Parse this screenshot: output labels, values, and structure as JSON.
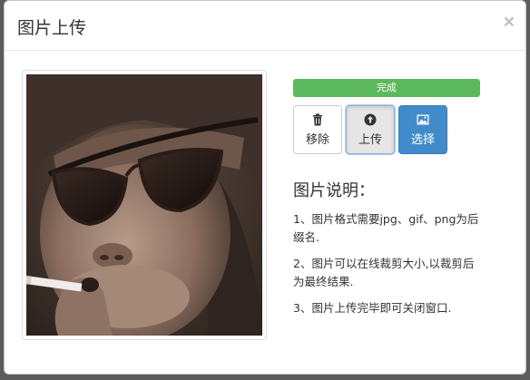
{
  "modal": {
    "title": "图片上传",
    "close_symbol": "×"
  },
  "photo": {
    "alt": "uploaded image preview: chimpanzee wearing sunglasses smoking a cigarette"
  },
  "progress": {
    "label": "完成",
    "value_percent": 100,
    "color": "#5cb85c"
  },
  "buttons": [
    {
      "label": "移除",
      "icon": "trash-icon",
      "state": "default"
    },
    {
      "label": "上传",
      "icon": "upload-circle-icon",
      "state": "active"
    },
    {
      "label": "选择",
      "icon": "picture-icon",
      "state": "primary"
    }
  ],
  "description": {
    "title": "图片说明：",
    "items": [
      "1、图片格式需要jpg、gif、png为后缀名.",
      "2、图片可以在线裁剪大小,以裁剪后为最终结果.",
      "3、图片上传完毕即可关闭窗口."
    ]
  },
  "colors": {
    "primary": "#428bca",
    "success": "#5cb85c"
  }
}
